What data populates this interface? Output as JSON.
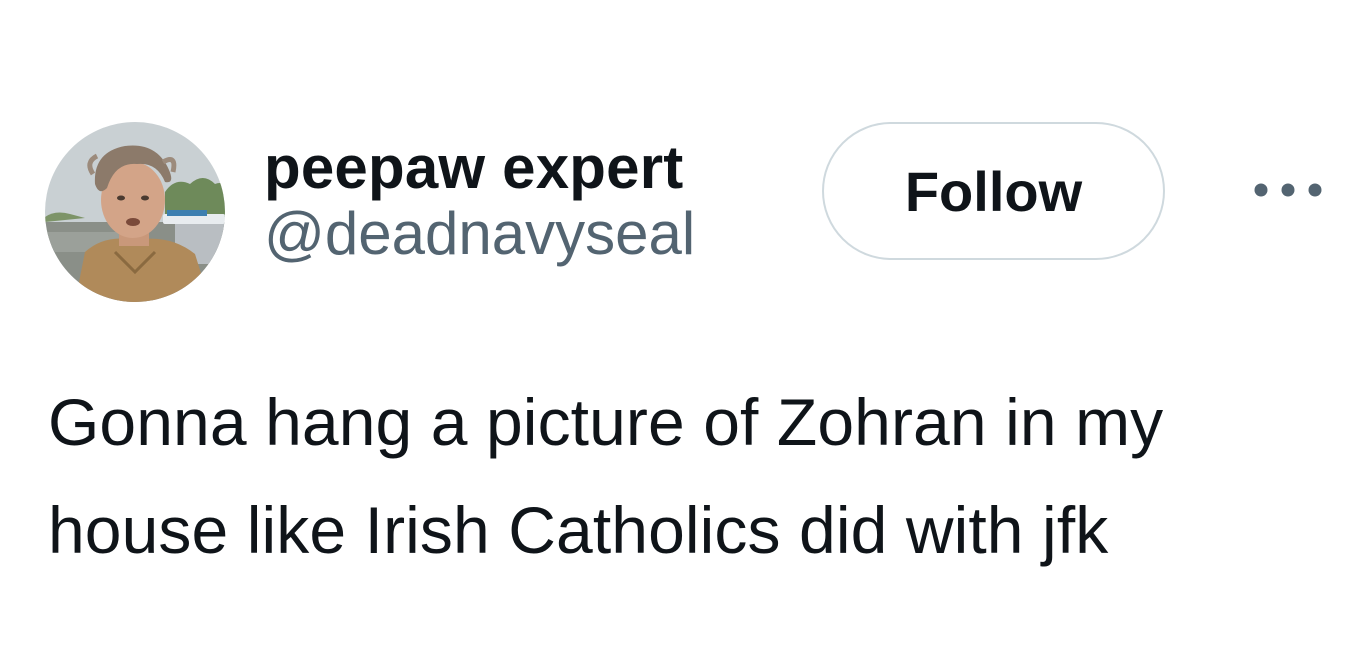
{
  "author": {
    "display_name": "peepaw expert",
    "handle": "@deadnavyseal",
    "avatar": "profile-photo"
  },
  "actions": {
    "follow_label": "Follow",
    "more_icon": "more-horizontal-icon"
  },
  "tweet": {
    "text": "Gonna hang a picture of Zohran in my house like Irish Catholics did with jfk"
  },
  "colors": {
    "text_primary": "#0f1419",
    "text_secondary": "#536471",
    "border": "#cfd9de",
    "background": "#ffffff"
  }
}
